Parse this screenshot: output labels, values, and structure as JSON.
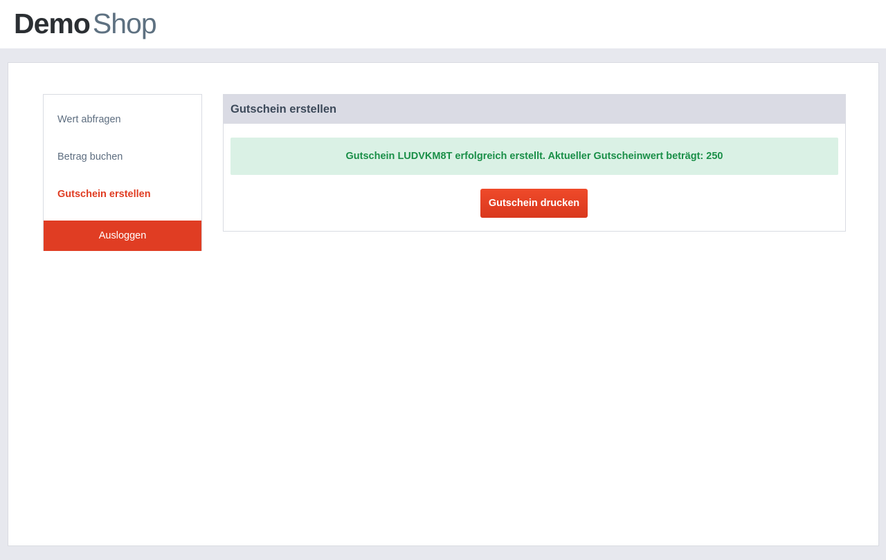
{
  "header": {
    "logo_part1": "Demo",
    "logo_part2": "Shop"
  },
  "sidebar": {
    "items": [
      {
        "label": "Wert abfragen",
        "active": false
      },
      {
        "label": "Betrag buchen",
        "active": false
      },
      {
        "label": "Gutschein erstellen",
        "active": true
      }
    ],
    "logout_label": "Ausloggen"
  },
  "panel": {
    "title": "Gutschein erstellen",
    "alert_text": "Gutschein LUDVKM8T erfolgreich erstellt. Aktueller Gutscheinwert beträgt: 250",
    "print_button_label": "Gutschein drucken"
  },
  "colors": {
    "accent": "#e03d23",
    "success_bg": "#daf1e5",
    "success_text": "#1a8f48",
    "panel_header_bg": "#dadbe4",
    "page_bg": "#e7e8ee"
  }
}
